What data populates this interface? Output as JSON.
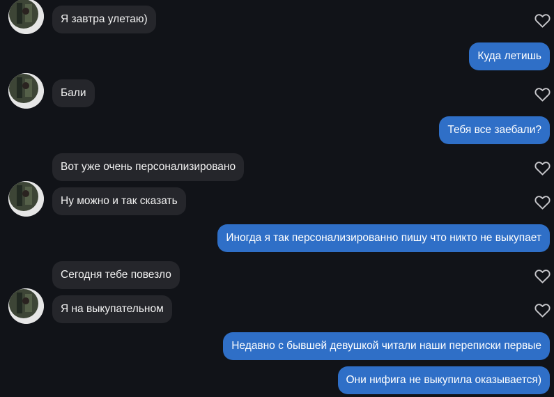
{
  "messages": [
    {
      "side": "in",
      "text": "Я завтра улетаю)"
    },
    {
      "side": "out",
      "text": "Куда летишь"
    },
    {
      "side": "in",
      "text": "Бали"
    },
    {
      "side": "out",
      "text": "Тебя все заебали?"
    },
    {
      "side": "in",
      "text": "Вот уже очень персонализировано"
    },
    {
      "side": "in",
      "text": "Ну можно и так сказать"
    },
    {
      "side": "out",
      "text": "Иногда я так персонализированно пишу что никто не выкупает"
    },
    {
      "side": "in",
      "text": "Сегодня тебе повезло"
    },
    {
      "side": "in",
      "text": "Я на выкупательном"
    },
    {
      "side": "out",
      "text": "Недавно с бывшей девушкой читали наши переписки первые"
    },
    {
      "side": "out",
      "text": "Они нифига не выкупила оказывается)"
    }
  ],
  "icons": {
    "like": "heart-outline-icon",
    "avatar": "contact-avatar"
  },
  "colors": {
    "background": "#111318",
    "incoming_bubble": "#25262b",
    "outgoing_bubble": "#2f6fc7",
    "like_icon": "#c8c8cc",
    "text": "#ffffff"
  }
}
